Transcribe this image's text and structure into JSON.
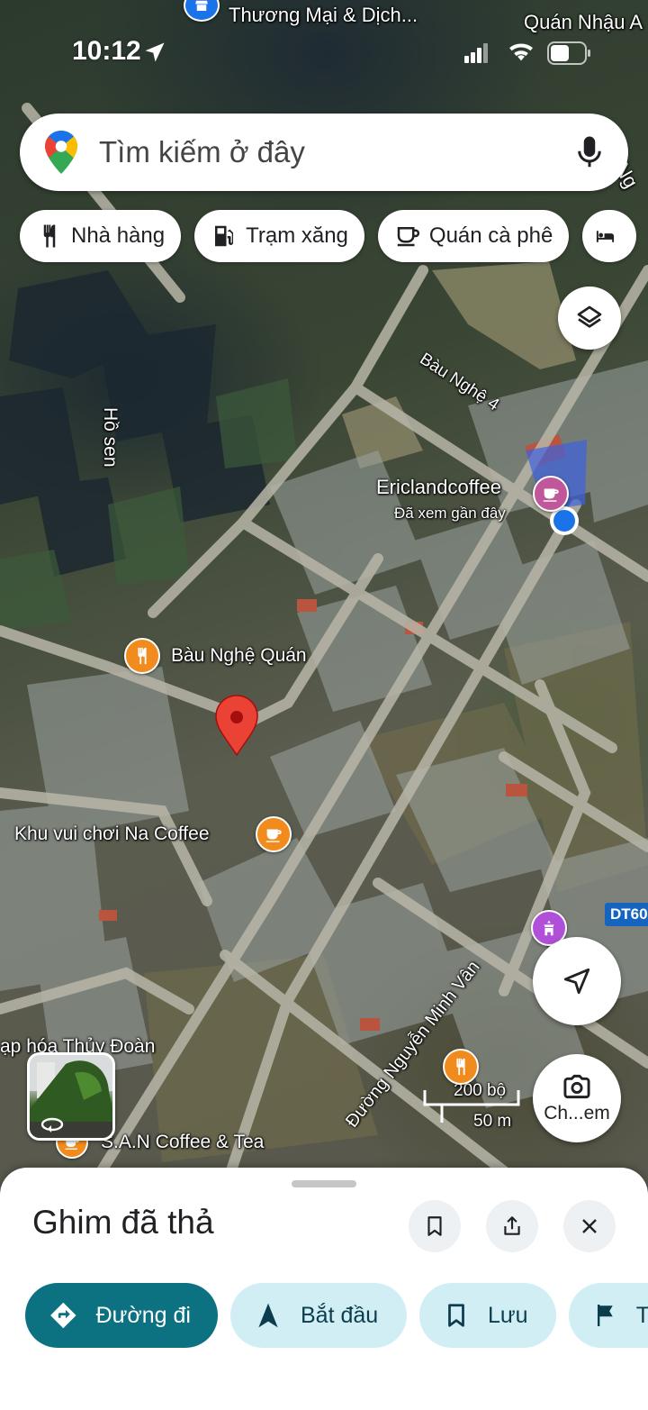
{
  "status_bar": {
    "time": "10:12"
  },
  "map_labels": {
    "top_place": "Thương Mại & Dịch...",
    "top_right_place": "Quán Nhậu A",
    "street_bau_nghe_4": "Bàu Nghệ 4",
    "lake": "Hồ sen",
    "ericland_name": "Ericlandcoffee",
    "ericland_sub": "Đã xem gần đây",
    "bau_nghe_quan": "Bàu Nghệ Quán",
    "na_coffee": "Khu vui chơi Na Coffee",
    "road_nguyen_minh_van": "Đường Nguyễn Minh Vân",
    "tap_hoa": "ạp hóa Thủy Đoàn",
    "san_coffee": "S.A.N Coffee & Tea",
    "right_edge": "Ng",
    "road_badge": "DT60"
  },
  "scale": {
    "top": "200 bộ",
    "bottom": "50 m"
  },
  "search": {
    "placeholder": "Tìm kiếm ở đây"
  },
  "chips": [
    {
      "label": "Nhà hàng",
      "icon": "restaurant-icon"
    },
    {
      "label": "Trạm xăng",
      "icon": "gas-station-icon"
    },
    {
      "label": "Quán cà phê",
      "icon": "coffee-icon"
    }
  ],
  "lens_button": {
    "label": "Ch...em"
  },
  "sheet": {
    "title": "Ghim đã thả",
    "actions": [
      {
        "label": "Đường đi",
        "icon": "directions-icon"
      },
      {
        "label": "Bắt đầu",
        "icon": "navigation-arrow-icon"
      },
      {
        "label": "Lưu",
        "icon": "bookmark-icon"
      },
      {
        "label": "T",
        "icon": "flag-icon"
      }
    ]
  },
  "colors": {
    "primary": "#0c7180",
    "tonal": "#d2eef5",
    "pin": "#ea4335",
    "poi_orange": "#f28b1d"
  }
}
